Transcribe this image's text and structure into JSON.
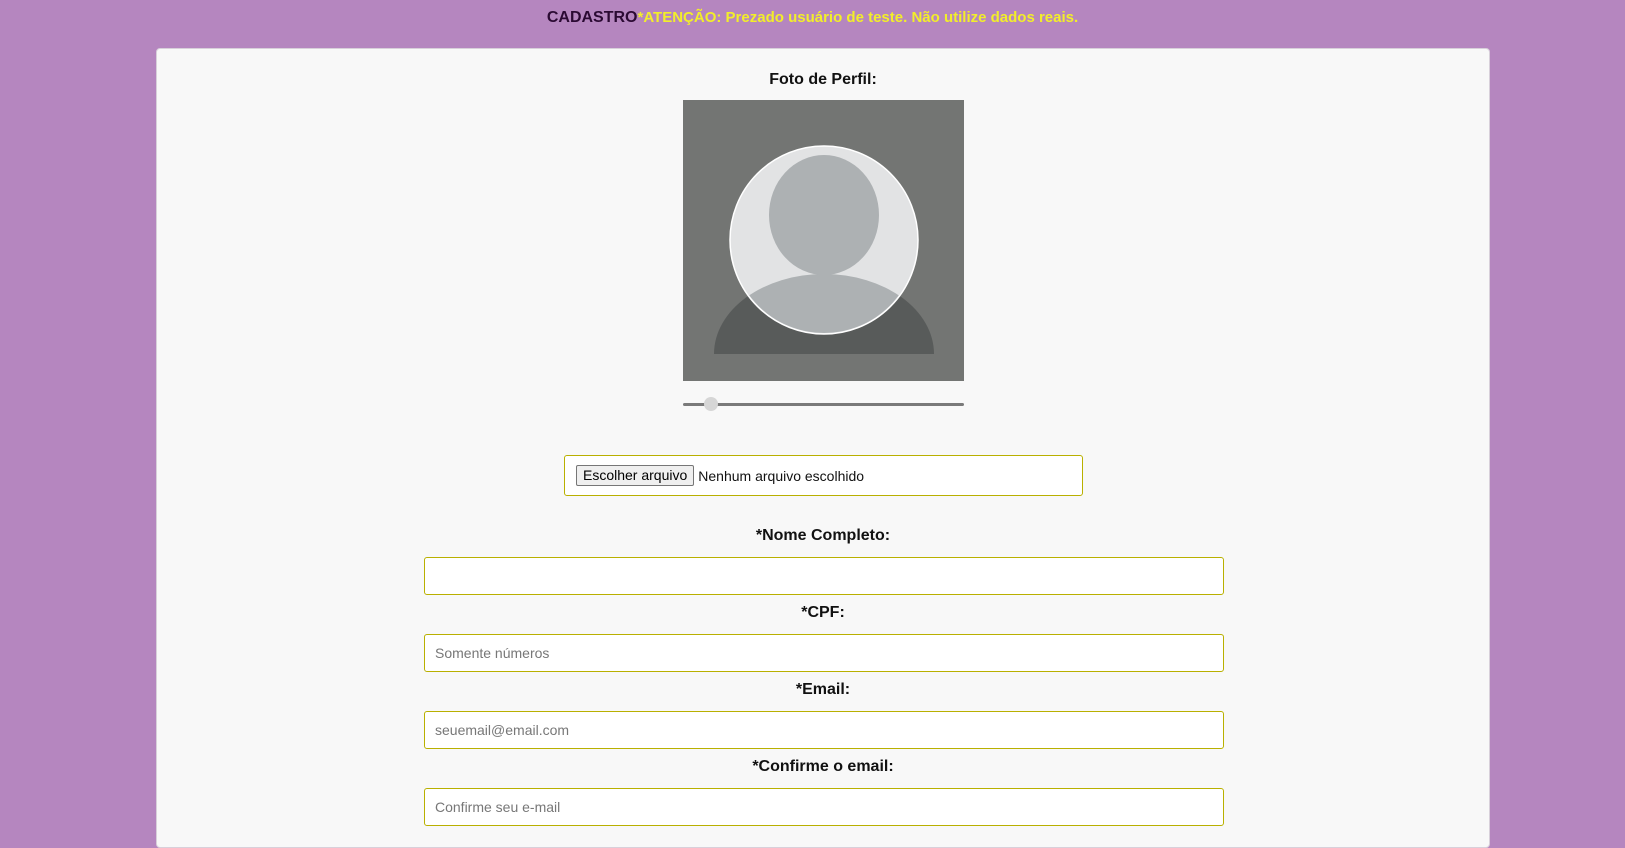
{
  "header": {
    "title": "CADASTRO",
    "warning": "*ATENÇÃO: Prezado usuário de teste. Não utilize dados reais."
  },
  "profile_photo": {
    "label": "Foto de Perfil:",
    "zoom_level": 0.08
  },
  "file_input": {
    "button_label": "Escolher arquivo",
    "status_text": "Nenhum arquivo escolhido"
  },
  "fields": {
    "full_name": {
      "label": "*Nome Completo:",
      "value": "",
      "placeholder": ""
    },
    "cpf": {
      "label": "*CPF:",
      "value": "",
      "placeholder": "Somente números"
    },
    "email": {
      "label": "*Email:",
      "value": "",
      "placeholder": "seuemail@email.com"
    },
    "confirm_email": {
      "label": "*Confirme o email:",
      "value": "",
      "placeholder": "Confirme seu e-mail"
    }
  },
  "colors": {
    "page_background": "#b586bf",
    "card_background": "#f8f8f8",
    "warning_text": "#f2ee2a",
    "title_text": "#2b0a33",
    "input_border": "#b9b000"
  },
  "icons": {
    "avatar_placeholder": "user-silhouette-icon"
  }
}
